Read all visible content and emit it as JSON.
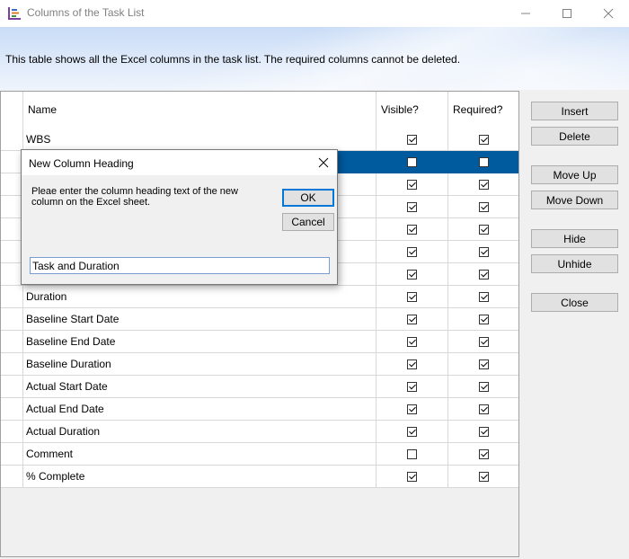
{
  "window": {
    "title": "Columns of the Task List",
    "icon": "task-list-icon"
  },
  "banner": {
    "text": "This table shows all the Excel columns in the task list. The required columns cannot be deleted."
  },
  "grid": {
    "headers": {
      "name": "Name",
      "visible": "Visible?",
      "required": "Required?"
    },
    "rows": [
      {
        "name": "WBS",
        "visible": true,
        "required": true,
        "selected": false
      },
      {
        "name": "",
        "visible": false,
        "required": false,
        "selected": true
      },
      {
        "name": "",
        "visible": true,
        "required": true,
        "selected": false
      },
      {
        "name": "",
        "visible": true,
        "required": true,
        "selected": false
      },
      {
        "name": "",
        "visible": true,
        "required": true,
        "selected": false
      },
      {
        "name": "",
        "visible": true,
        "required": true,
        "selected": false
      },
      {
        "name": "",
        "visible": true,
        "required": true,
        "selected": false
      },
      {
        "name": "Duration",
        "visible": true,
        "required": true,
        "selected": false
      },
      {
        "name": "Baseline Start Date",
        "visible": true,
        "required": true,
        "selected": false
      },
      {
        "name": "Baseline End Date",
        "visible": true,
        "required": true,
        "selected": false
      },
      {
        "name": "Baseline Duration",
        "visible": true,
        "required": true,
        "selected": false
      },
      {
        "name": "Actual Start Date",
        "visible": true,
        "required": true,
        "selected": false
      },
      {
        "name": "Actual End Date",
        "visible": true,
        "required": true,
        "selected": false
      },
      {
        "name": "Actual Duration",
        "visible": true,
        "required": true,
        "selected": false
      },
      {
        "name": "Comment",
        "visible": false,
        "required": true,
        "selected": false
      },
      {
        "name": "% Complete",
        "visible": true,
        "required": true,
        "selected": false
      }
    ]
  },
  "buttons": {
    "insert": "Insert",
    "delete": "Delete",
    "move_up": "Move Up",
    "move_down": "Move Down",
    "hide": "Hide",
    "unhide": "Unhide",
    "close": "Close"
  },
  "dialog": {
    "title": "New Column Heading",
    "message": "Pleae enter the column heading text of the new column on the Excel sheet.",
    "ok": "OK",
    "cancel": "Cancel",
    "input_value": "Task and Duration"
  },
  "colors": {
    "selection": "#005a9e",
    "focus_border": "#0078d7"
  }
}
